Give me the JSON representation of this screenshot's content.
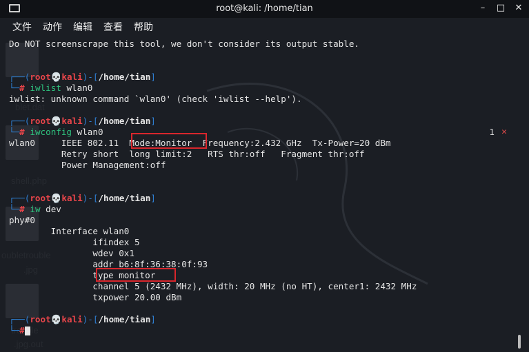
{
  "window": {
    "title": "root@kali: /home/tian",
    "minimize": "–",
    "maximize": "□",
    "close": "✕"
  },
  "menu": [
    "文件",
    "动作",
    "编辑",
    "查看",
    "帮助"
  ],
  "desktop_labels": [
    "blet.dat",
    "shell.php",
    "oubletrouble",
    ".jpg",
    "trouble",
    ".jpg.out"
  ],
  "prompt": {
    "user": "root",
    "skull": "💀",
    "host": "kali",
    "path": "/home/tian",
    "hash": "#"
  },
  "terminal": {
    "top_line": "Do NOT screenscrape this tool, we don't consider its output stable.",
    "cmd1_name": "iwlist",
    "cmd1_args": " wlan0",
    "cmd1_out": "iwlist: unknown command `wlan0' (check 'iwlist --help').",
    "cmd2_name": "iwconfig",
    "cmd2_args": " wlan0",
    "cmd2_out": [
      "wlan0     IEEE 802.11  Mode:Monitor  Frequency:2.432 GHz  Tx-Power=20 dBm",
      "          Retry short  long limit:2   RTS thr:off   Fragment thr:off",
      "          Power Management:off"
    ],
    "cmd3_name": "iw",
    "cmd3_args": " dev",
    "cmd3_out": [
      "phy#0",
      "        Interface wlan0",
      "                ifindex 5",
      "                wdev 0x1",
      "                addr b6:8f:36:38:0f:93",
      "                type monitor",
      "                channel 5 (2432 MHz), width: 20 MHz (no HT), center1: 2432 MHz",
      "                txpower 20.00 dBm"
    ],
    "tab_count": "1",
    "tab_close": "✕"
  }
}
